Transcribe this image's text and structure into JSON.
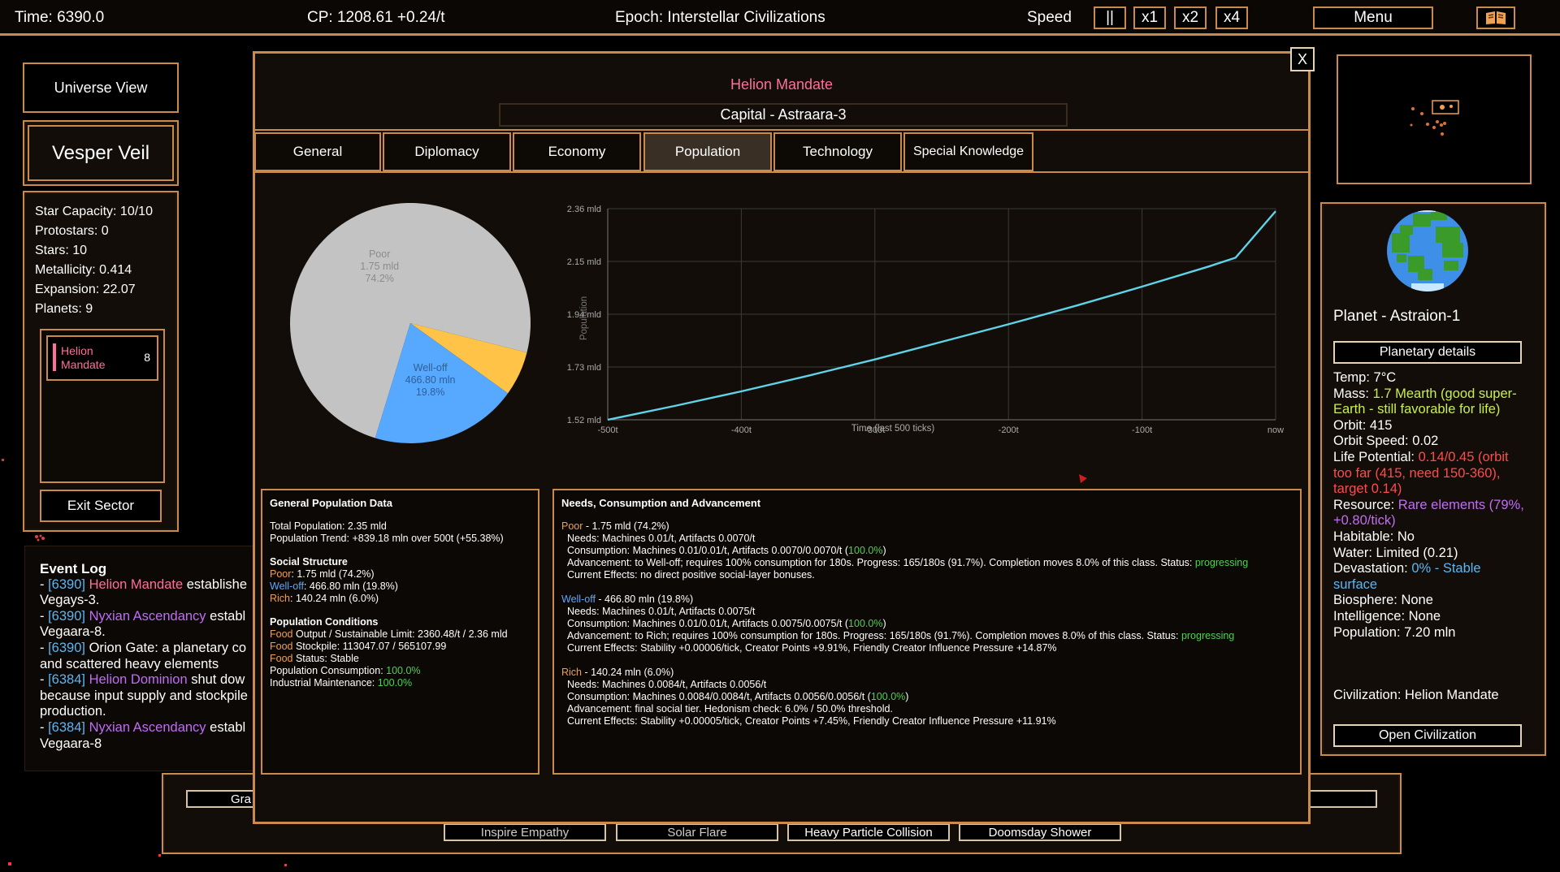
{
  "topbar": {
    "time": "Time: 6390.0",
    "cp": "CP: 1208.61 +0.24/t",
    "epoch": "Epoch: Interstellar Civilizations",
    "speed_label": "Speed",
    "pause": "||",
    "x1": "x1",
    "x2": "x2",
    "x4": "x4",
    "menu": "Menu",
    "book_icon": "book-icon"
  },
  "left": {
    "universe_view": "Universe View",
    "sector_name": "Vesper Veil",
    "stats": [
      "Star Capacity: 10/10",
      "Protostars: 0",
      "Stars: 10",
      "Metallicity: 0.414",
      "Expansion: 22.07",
      "Planets: 9"
    ],
    "civ_entry": {
      "name_line1": "Helion",
      "name_line2": "Mandate",
      "count": "8",
      "color": "#ff6f9a"
    },
    "exit_sector": "Exit Sector"
  },
  "event_log": {
    "title": "Event Log",
    "entries": [
      {
        "tick": "[6390]",
        "civ": "Helion Mandate",
        "civ_color": "#ff6f9a",
        "text": " establishe",
        "cont": "Vegays-3."
      },
      {
        "tick": "[6390]",
        "civ": "Nyxian Ascendancy",
        "civ_color": "#c16cf7",
        "text": " establ",
        "cont": "Vegaara-8."
      },
      {
        "tick": "[6390]",
        "civ": "",
        "civ_color": "#ffffff",
        "text": "Orion Gate: a planetary co",
        "cont": "and scattered heavy elements"
      },
      {
        "tick": "[6384]",
        "civ": "Helion Dominion",
        "civ_color": "#c16cf7",
        "text": " shut dow",
        "cont": "because input supply and stockpile",
        "cont2": "production."
      },
      {
        "tick": "[6384]",
        "civ": "Nyxian Ascendancy",
        "civ_color": "#c16cf7",
        "text": " establ",
        "cont": "Vegaara-8"
      }
    ]
  },
  "bottom_bar": {
    "left_btn": "Gra",
    "right_btn": "onflict",
    "powers": [
      "Inspire Empathy",
      "Solar Flare",
      "Heavy Particle Collision",
      "Doomsday Shower"
    ]
  },
  "modal": {
    "civ_name": "Helion Mandate",
    "capital": "Capital - Astraara-3",
    "close": "X",
    "tabs": [
      "General",
      "Diplomacy",
      "Economy",
      "Population",
      "Technology",
      "Special Knowledge"
    ],
    "active_tab": "Population"
  },
  "pie": {
    "slices": [
      {
        "name": "Poor",
        "value": "1.75 mld",
        "pct": 74.2,
        "pct_label": "74.2%",
        "color": "#c3c3c3",
        "label_color": "#8c8c8c"
      },
      {
        "name": "Rich",
        "value": "140.24 mln",
        "pct": 6.0,
        "pct_label": "6.0%",
        "color": "#ffc447",
        "label_color": "#b28830"
      },
      {
        "name": "Well-off",
        "value": "466.80 mln",
        "pct": 19.8,
        "pct_label": "19.8%",
        "color": "#57a8ff",
        "label_color": "#2e5f97"
      }
    ]
  },
  "chart_data": {
    "type": "line",
    "xlabel": "Time (last 500 ticks)",
    "ylabel": "Population",
    "x_ticks": [
      "-500t",
      "-400t",
      "-300t",
      "-200t",
      "-100t",
      "now"
    ],
    "y_ticks": [
      "1.52 mld",
      "1.73 mld",
      "1.94 mld",
      "2.15 mld",
      "2.36 mld"
    ],
    "ylim": [
      1.52,
      2.36
    ],
    "xlim": [
      -500,
      0
    ],
    "series": [
      {
        "color": "#5fd3e8",
        "x": [
          -500,
          -450,
          -400,
          -350,
          -300,
          -250,
          -200,
          -150,
          -100,
          -50,
          -30,
          0
        ],
        "y": [
          1.52,
          1.575,
          1.633,
          1.695,
          1.76,
          1.83,
          1.9,
          1.973,
          2.05,
          2.13,
          2.165,
          2.35
        ]
      }
    ]
  },
  "general_pop": {
    "title": "General Population Data",
    "total": "Total Population: 2.35 mld",
    "trend": "Population Trend: +839.18 mln over 500t (+55.38%)",
    "social_title": "Social Structure",
    "poor_label": "Poor",
    "poor_val": ": 1.75 mld (74.2%)",
    "welloff_label": "Well-off",
    "welloff_val": ": 466.80 mln (19.8%)",
    "rich_label": "Rich",
    "rich_val": ": 140.24 mln (6.0%)",
    "cond_title": "Population Conditions",
    "food_word": "Food",
    "food1": " Output / Sustainable Limit: 2360.48/t / 2.36 mld",
    "food2": " Stockpile: 113047.07 / 565107.99",
    "food3": " Status: Stable",
    "pop_cons": "Population Consumption: ",
    "pop_cons_val": "100.0%",
    "ind_maint": "Industrial Maintenance: ",
    "ind_maint_val": "100.0%"
  },
  "needs": {
    "title": "Needs, Consumption and Advancement",
    "poor": {
      "label": "Poor",
      "head": " - 1.75 mld (74.2%)",
      "needs": "Needs: Machines 0.01/t, Artifacts 0.0070/t",
      "cons": "Consumption: Machines 0.01/0.01/t, Artifacts 0.0070/0.0070/t (",
      "cons_pct": "100.0%",
      "adv": "Advancement: to Well-off; requires 100% consumption for 180s. Progress: 165/180s (91.7%). Completion moves 8.0% of this class. Status: ",
      "status": "progressing",
      "effects": "Current Effects: no direct positive social-layer bonuses."
    },
    "welloff": {
      "label": "Well-off",
      "head": " - 466.80 mln (19.8%)",
      "needs": "Needs: Machines 0.01/t, Artifacts 0.0075/t",
      "cons": "Consumption: Machines 0.01/0.01/t, Artifacts 0.0075/0.0075/t (",
      "cons_pct": "100.0%",
      "adv": "Advancement: to Rich; requires 100% consumption for 180s. Progress: 165/180s (91.7%). Completion moves 8.0% of this class. Status: ",
      "status": "progressing",
      "effects": "Current Effects: Stability +0.00006/tick, Creator Points +9.91%, Friendly Creator Influence Pressure +14.87%"
    },
    "rich": {
      "label": "Rich",
      "head": " - 140.24 mln (6.0%)",
      "needs": "Needs: Machines 0.0084/t, Artifacts 0.0056/t",
      "cons": "Consumption: Machines 0.0084/0.0084/t, Artifacts 0.0056/0.0056/t (",
      "cons_pct": "100.0%",
      "adv": "Advancement: final social tier. Hedonism check: 6.0% / 50.0% threshold.",
      "effects": "Current Effects: Stability +0.00005/tick, Creator Points +7.45%, Friendly Creator Influence Pressure +11.91%"
    }
  },
  "right": {
    "planet_title": "Planet - Astraion-1",
    "planetary_details": "Planetary details",
    "temp": "Temp: 7°C",
    "mass_label": "Mass: ",
    "mass_val": "1.7 Mearth (good super-Earth - still favorable for life)",
    "orbit": "Orbit: 415",
    "orbit_speed": "Orbit Speed: 0.02",
    "life_label": "Life Potential: ",
    "life_val": "0.14/0.45 (orbit too far (415, need 150-360), target 0.14)",
    "resource_label": "Resource: ",
    "resource_val": "Rare elements (79%, +0.80/tick)",
    "habitable": "Habitable: No",
    "water": "Water: Limited (0.21)",
    "devastation_label": "Devastation: ",
    "devastation_val": "0% - Stable surface",
    "biosphere": "Biosphere: None",
    "intelligence": "Intelligence: None",
    "population": "Population: 7.20 mln",
    "civilization": "Civilization: Helion Mandate",
    "open_civ": "Open Civilization"
  }
}
